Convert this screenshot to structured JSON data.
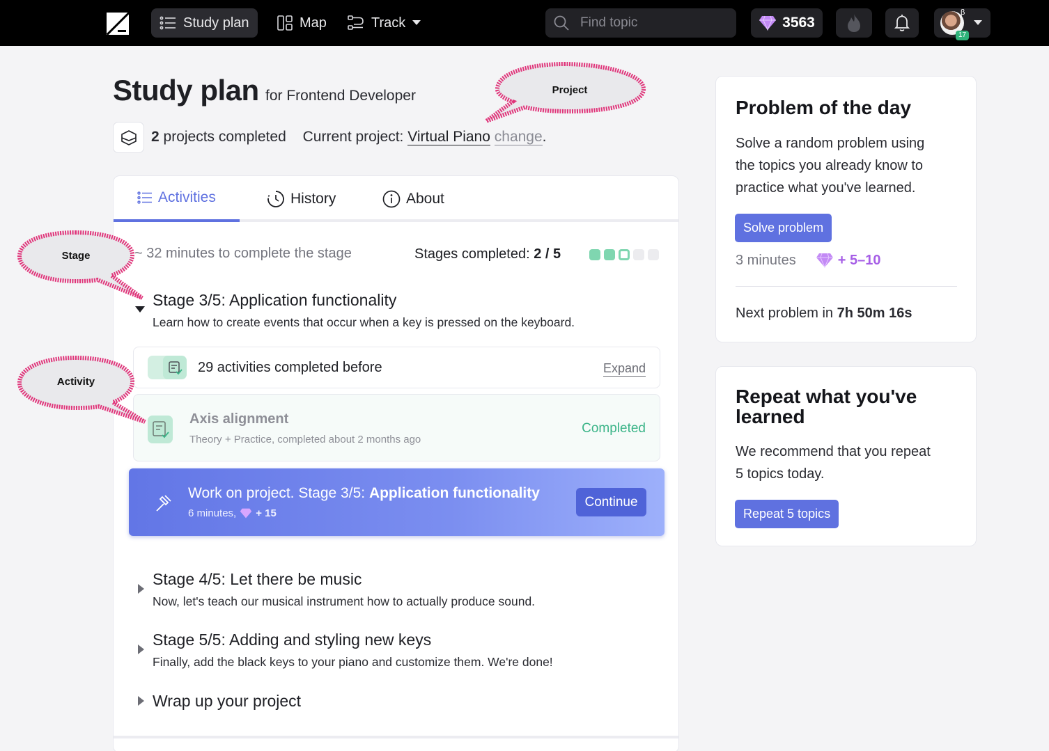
{
  "topbar": {
    "nav": [
      {
        "label": "Study plan",
        "icon": "list-icon"
      },
      {
        "label": "Map",
        "icon": "map-icon"
      },
      {
        "label": "Track",
        "icon": "track-icon"
      }
    ],
    "search_placeholder": "Find topic",
    "gems": "3563",
    "beta_badge": "β",
    "level": "17"
  },
  "header": {
    "title": "Study plan",
    "subtitle": "for Frontend Developer",
    "projects_count": "2",
    "projects_text": "projects completed",
    "current_label": "Current project:",
    "current_project": "Virtual Piano",
    "change_link": "change",
    "period": "."
  },
  "tabs": [
    {
      "label": "Activities",
      "icon": "list-icon"
    },
    {
      "label": "History",
      "icon": "clock-icon"
    },
    {
      "label": "About",
      "icon": "info-icon"
    }
  ],
  "stage_meta": {
    "time_left": "~ 32 minutes to complete the stage",
    "completed_label": "Stages completed:",
    "completed_value": "2 / 5",
    "progress": {
      "completed": 2,
      "current": 3,
      "total": 5
    }
  },
  "stages": [
    {
      "title": "Stage 3/5: Application functionality",
      "desc": "Learn how to create events that occur when a key is pressed on the keyboard."
    },
    {
      "title": "Stage 4/5: Let there be music",
      "desc": "Now, let's teach our musical instrument how to actually produce sound."
    },
    {
      "title": "Stage 5/5: Adding and styling new keys",
      "desc": "Finally, add the black keys to your piano and customize them. We're done!"
    },
    {
      "title": "Wrap up your project",
      "desc": ""
    }
  ],
  "activities": {
    "before_text": "29 activities completed before",
    "expand": "Expand",
    "axis_title": "Axis alignment",
    "axis_sub": "Theory + Practice, completed about 2 months ago",
    "axis_status": "Completed"
  },
  "cta": {
    "prefix": "Work on project. Stage 3/5:",
    "bold": "Application functionality",
    "minutes": "6 minutes,",
    "reward": "+ 15",
    "button": "Continue"
  },
  "problem_card": {
    "title": "Problem of the day",
    "text_lines": [
      "Solve a random problem using",
      "the topics you already know to",
      "practice what you've learned."
    ],
    "button": "Solve problem",
    "minutes": "3 minutes",
    "reward": "+ 5–10",
    "next_label": "Next problem in",
    "next_time": "7h 50m 16s"
  },
  "repeat_card": {
    "title_lines": [
      "Repeat what you've",
      "learned"
    ],
    "text_lines": [
      "We recommend that you repeat",
      "5 topics today."
    ],
    "button": "Repeat 5 topics"
  },
  "annotations": {
    "project": "Project",
    "stage": "Stage",
    "activity": "Activity"
  },
  "colors": {
    "accent": "#5f71e0",
    "success": "#3bb488",
    "annotation": "#e0357a",
    "gem": "#b873f0"
  }
}
